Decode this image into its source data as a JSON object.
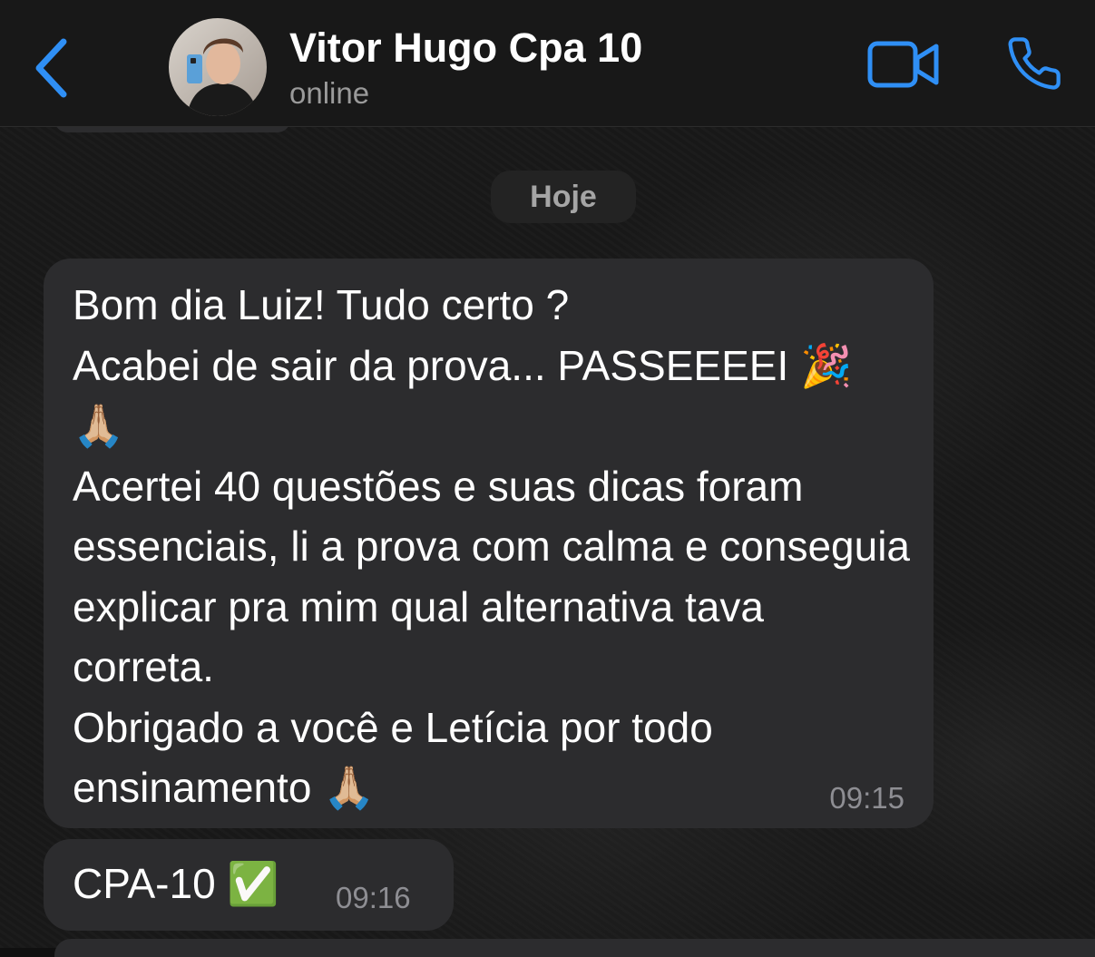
{
  "header": {
    "back_icon": "chevron-left-icon",
    "contact_name": "Vitor Hugo Cpa 10",
    "status": "online",
    "video_icon": "video-camera-icon",
    "call_icon": "phone-icon",
    "accent_color": "#2f8ff5"
  },
  "chat": {
    "date_label": "Hoje",
    "messages": [
      {
        "text": "Bom dia Luiz! Tudo certo ?\nAcabei de sair da prova... PASSEEEEI 🎉\n🙏🏼\nAcertei 40 questões e suas dicas foram essenciais, li a prova com calma e conseguia explicar pra mim qual alternativa tava correta.\nObrigado a você e Letícia por todo ensinamento 🙏🏼",
        "time": "09:15"
      },
      {
        "text": "CPA-10 ✅",
        "time": "09:16"
      }
    ]
  },
  "colors": {
    "background": "#181818",
    "bubble_incoming": "#2c2c2e",
    "timestamp": "#8e8e93"
  }
}
